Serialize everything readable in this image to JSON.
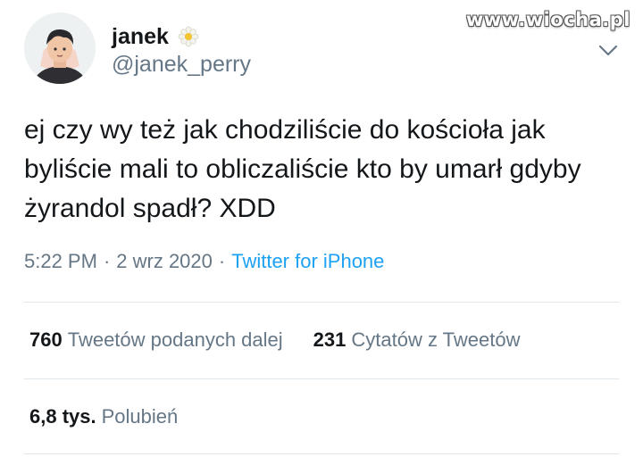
{
  "watermark": "www.wiocha.pl",
  "author": {
    "name": "janek",
    "handle": "@janek_perry",
    "badge_icon": "flower-icon"
  },
  "tweet": {
    "text": "ej czy wy też jak chodziliście do kościoła jak byliście mali to obliczaliście kto by umarł gdyby żyrandol spadł? XDD",
    "time": "5:22 PM",
    "date": "2 wrz 2020",
    "separator": "·",
    "source": "Twitter for iPhone"
  },
  "stats": {
    "retweets_count": "760",
    "retweets_label": "Tweetów podanych dalej",
    "quotes_count": "231",
    "quotes_label": "Cytatów z Tweetów",
    "likes_count": "6,8 tys.",
    "likes_label": "Polubień"
  },
  "colors": {
    "text": "#14171a",
    "muted": "#657786",
    "link": "#1da1f2",
    "divider": "#e1e8ed"
  }
}
